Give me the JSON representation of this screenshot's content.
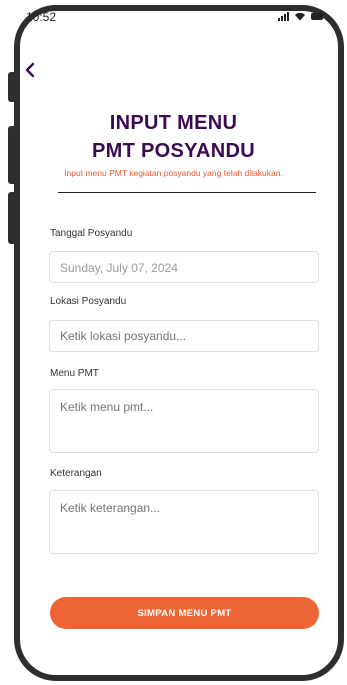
{
  "status_bar": {
    "time": "10:52"
  },
  "header": {
    "back_icon": "chevron-left-icon",
    "title_line1": "INPUT MENU",
    "title_line2": "PMT POSYANDU",
    "subtitle": "Input menu PMT kegiatan posyandu yang telah dilakukan."
  },
  "form": {
    "date": {
      "label": "Tanggal Posyandu",
      "value": "Sunday, July 07, 2024"
    },
    "location": {
      "label": "Lokasi Posyandu",
      "placeholder": "Ketik lokasi posyandu..."
    },
    "menu": {
      "label": "Menu PMT",
      "placeholder": "Ketik menu pmt..."
    },
    "notes": {
      "label": "Keterangan",
      "placeholder": "Ketik keterangan..."
    }
  },
  "actions": {
    "save_label": "SIMPAN MENU PMT"
  },
  "colors": {
    "accent": "#ee6535",
    "title": "#3b0a55"
  }
}
